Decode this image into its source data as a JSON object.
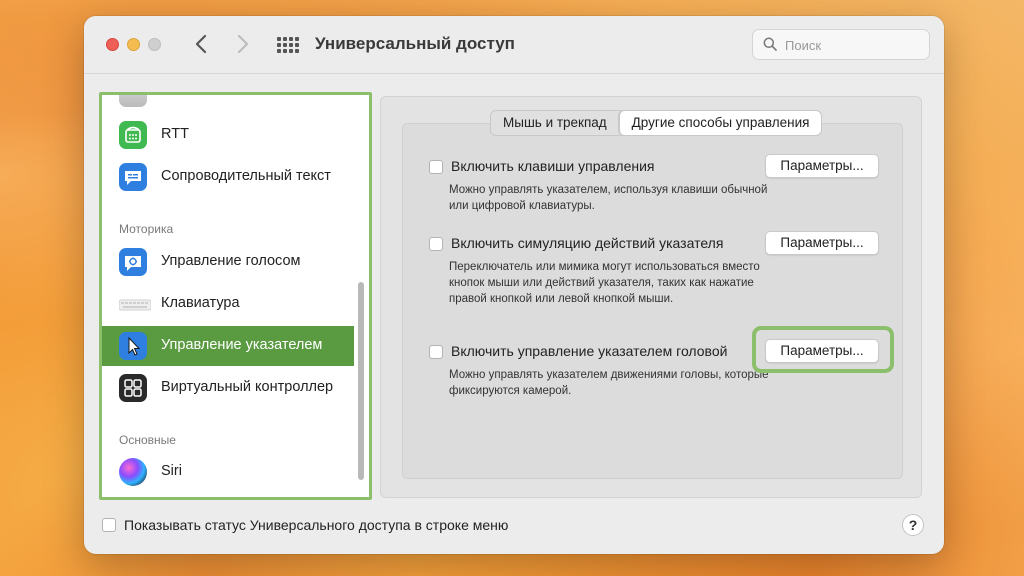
{
  "window": {
    "title": "Универсальный доступ"
  },
  "search": {
    "placeholder": "Поиск"
  },
  "sidebar": {
    "items": [
      {
        "label": "RTT",
        "icon": "rtt-phone-icon"
      },
      {
        "label": "Сопроводительный текст",
        "icon": "captions-icon"
      },
      {
        "label": "Управление голосом",
        "icon": "voice-control-icon"
      },
      {
        "label": "Клавиатура",
        "icon": "keyboard-icon"
      },
      {
        "label": "Управление указателем",
        "icon": "pointer-icon",
        "selected": true
      },
      {
        "label": "Виртуальный контроллер",
        "icon": "switch-control-icon"
      },
      {
        "label": "Siri",
        "icon": "siri-icon"
      }
    ],
    "sections": {
      "motor": "Моторика",
      "general": "Основные"
    }
  },
  "tabs": [
    {
      "label": "Мышь и трекпад",
      "active": false
    },
    {
      "label": "Другие способы управления",
      "active": true
    }
  ],
  "options": [
    {
      "label": "Включить клавиши управления",
      "desc": "Можно управлять указателем, используя клавиши обычной или цифровой клавиатуры.",
      "button": "Параметры...",
      "checked": false
    },
    {
      "label": "Включить симуляцию действий указателя",
      "desc": "Переключатель или мимика могут использоваться вместо кнопок мыши или действий указателя, таких как нажатие правой кнопкой или левой кнопкой мыши.",
      "button": "Параметры...",
      "checked": false
    },
    {
      "label": "Включить управление указателем головой",
      "desc": "Можно управлять указателем движениями головы, которые фиксируются камерой.",
      "button": "Параметры...",
      "checked": false
    }
  ],
  "footer": {
    "menu_status_label": "Показывать статус Универсального доступа в строке меню",
    "help_label": "?"
  },
  "colors": {
    "accent_selected": "#5a9b42",
    "highlight": "#8cbf6b"
  }
}
